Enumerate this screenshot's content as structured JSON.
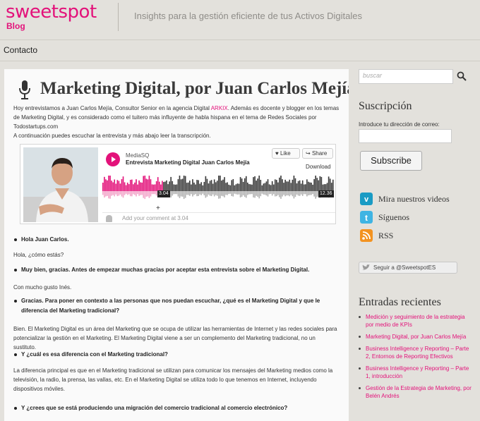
{
  "header": {
    "logo": "sweetspot",
    "logo_sub": "Blog",
    "tagline": "Insights para la gestión eficiente de tus Activos Digitales"
  },
  "nav": {
    "contacto": "Contacto"
  },
  "post": {
    "title": "Marketing Digital, por Juan Carlos Mejía",
    "intro_a": "Hoy entrevistamos a Juan Carlos Mejía, Consultor Senior  en la agencia Digital ",
    "intro_link": "ARKIX",
    "intro_b": ". Además es docente y blogger en los temas de Marketing Digital, y es considerado como el tuitero más influyente de habla hispana en el tema de Redes Sociales por Todostartups.com",
    "intro2": "A continuación puedes escuchar la entrevista y más abajo leer la transcripción.",
    "q1": "Hola Juan Carlos.",
    "a1": "Hola, ¿cómo estás?",
    "q2": "Muy bien, gracias.  Antes de empezar muchas gracias por aceptar esta entrevista sobre el Marketing Digital.",
    "a2": "Con mucho gusto Inés.",
    "q3": "Gracias. Para poner en contexto a las personas que nos puedan escuchar, ¿qué es el Marketing Digital y que le diferencia del Marketing tradicional?",
    "a3": "Bien. El Marketing Digital es un área del Marketing que se ocupa de utilizar las herramientas de Internet y las redes sociales para potencializar la gestión en el Marketing.  El Marketing Digital viene a ser un complemento del Marketing tradicional, no un sustituto.",
    "q4": "Y ¿cuál es esa diferencia con el Marketing tradicional?",
    "a4": "La diferencia principal es que en el Marketing tradicional se utilizan para comunicar los mensajes del Marketing medios como la televisión, la radio, la prensa, las vallas, etc. En el Marketing Digital se utiliza todo lo que tenemos en Internet, incluyendo dispositivos móviles.",
    "q5": "Y ¿crees que se está produciendo una migración del comercio tradicional al comercio electrónico?"
  },
  "player": {
    "user": "MediaSQ",
    "track": "Entrevista Marketing Digital Juan Carlos Mejía",
    "like": "Like",
    "share": "Share",
    "download": "Download",
    "time_current": "3.04",
    "time_total": "12.36",
    "progress": 0.26,
    "comment_placeholder": "Add your comment at 3.04"
  },
  "sidebar": {
    "search_placeholder": "buscar",
    "subscription_title": "Suscripción",
    "email_label": "Introduce tu dirección de correo:",
    "subscribe": "Subscribe",
    "social": [
      {
        "label": "Mira nuestros videos",
        "icon": "vimeo-icon"
      },
      {
        "label": "Síguenos",
        "icon": "twitter-icon"
      },
      {
        "label": "RSS",
        "icon": "rss-icon"
      }
    ],
    "follow": "Seguir a @SweetspotES",
    "recent_title": "Entradas recientes",
    "recent": [
      "Medición y seguimiento de la estrategia por medio de KPIs",
      "Marketing Digital, por Juan Carlos Mejía",
      "Business Intelligence y Reporting – Parte 2, Entornos de Reporting Efectivos",
      "Business Intelligence y Reporting – Parte 1, introducción",
      "Gestión de la Estrategia de Marketing, por Belén Andrés"
    ]
  },
  "colors": {
    "accent": "#e3127a",
    "background": "#e3e1dc"
  }
}
